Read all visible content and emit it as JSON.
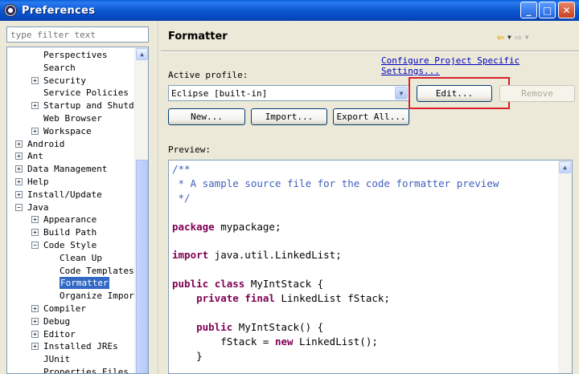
{
  "window": {
    "title": "Preferences",
    "min_glyph": "_",
    "max_glyph": "□",
    "close_glyph": "✕"
  },
  "sidebar": {
    "filter_placeholder": "type filter text",
    "items": [
      {
        "label": "Perspectives",
        "indent": 2,
        "expander": "none"
      },
      {
        "label": "Search",
        "indent": 2,
        "expander": "none"
      },
      {
        "label": "Security",
        "indent": 2,
        "expander": "+"
      },
      {
        "label": "Service Policies",
        "indent": 2,
        "expander": "none"
      },
      {
        "label": "Startup and Shutdo",
        "indent": 2,
        "expander": "+"
      },
      {
        "label": "Web Browser",
        "indent": 2,
        "expander": "none"
      },
      {
        "label": "Workspace",
        "indent": 2,
        "expander": "+"
      },
      {
        "label": "Android",
        "indent": 1,
        "expander": "+"
      },
      {
        "label": "Ant",
        "indent": 1,
        "expander": "+"
      },
      {
        "label": "Data Management",
        "indent": 1,
        "expander": "+"
      },
      {
        "label": "Help",
        "indent": 1,
        "expander": "+"
      },
      {
        "label": "Install/Update",
        "indent": 1,
        "expander": "+"
      },
      {
        "label": "Java",
        "indent": 1,
        "expander": "-"
      },
      {
        "label": "Appearance",
        "indent": 2,
        "expander": "+"
      },
      {
        "label": "Build Path",
        "indent": 2,
        "expander": "+"
      },
      {
        "label": "Code Style",
        "indent": 2,
        "expander": "-"
      },
      {
        "label": "Clean Up",
        "indent": 3,
        "expander": "none"
      },
      {
        "label": "Code Templates",
        "indent": 3,
        "expander": "none"
      },
      {
        "label": "Formatter",
        "indent": 3,
        "expander": "none",
        "selected": true
      },
      {
        "label": "Organize Import",
        "indent": 3,
        "expander": "none"
      },
      {
        "label": "Compiler",
        "indent": 2,
        "expander": "+"
      },
      {
        "label": "Debug",
        "indent": 2,
        "expander": "+"
      },
      {
        "label": "Editor",
        "indent": 2,
        "expander": "+"
      },
      {
        "label": "Installed JREs",
        "indent": 2,
        "expander": "+"
      },
      {
        "label": "JUnit",
        "indent": 2,
        "expander": "none"
      },
      {
        "label": "Properties Files E",
        "indent": 2,
        "expander": "none"
      }
    ]
  },
  "main": {
    "title": "Formatter",
    "config_link": "Configure Project Specific Settings...",
    "active_profile_label": "Active profile:",
    "profile_value": "Eclipse [built-in]",
    "buttons": {
      "edit": "Edit...",
      "remove": "Remove",
      "new": "New...",
      "import": "Import...",
      "export": "Export All..."
    },
    "preview_label": "Preview:",
    "code": [
      [
        {
          "t": "/**",
          "c": "cm"
        }
      ],
      [
        {
          "t": " * A sample source file for the code formatter preview",
          "c": "cm"
        }
      ],
      [
        {
          "t": " */",
          "c": "cm"
        }
      ],
      [],
      [
        {
          "t": "package",
          "c": "kw"
        },
        {
          "t": " mypackage;",
          "c": ""
        }
      ],
      [],
      [
        {
          "t": "import",
          "c": "kw"
        },
        {
          "t": " java.util.LinkedList;",
          "c": ""
        }
      ],
      [],
      [
        {
          "t": "public",
          "c": "kw"
        },
        {
          "t": " ",
          "c": ""
        },
        {
          "t": "class",
          "c": "kw"
        },
        {
          "t": " MyIntStack {",
          "c": ""
        }
      ],
      [
        {
          "t": "    ",
          "c": ""
        },
        {
          "t": "private",
          "c": "kw"
        },
        {
          "t": " ",
          "c": ""
        },
        {
          "t": "final",
          "c": "kw"
        },
        {
          "t": " LinkedList fStack;",
          "c": ""
        }
      ],
      [],
      [
        {
          "t": "    ",
          "c": ""
        },
        {
          "t": "public",
          "c": "kw"
        },
        {
          "t": " MyIntStack() {",
          "c": ""
        }
      ],
      [
        {
          "t": "        fStack = ",
          "c": ""
        },
        {
          "t": "new",
          "c": "kw"
        },
        {
          "t": " LinkedList();",
          "c": ""
        }
      ],
      [
        {
          "t": "    }",
          "c": ""
        }
      ]
    ]
  },
  "colors": {
    "selection": "#316ac5",
    "keyword": "#7f0055",
    "comment": "#3f5fbf",
    "link": "#0000c0",
    "highlight_box": "#d9202a"
  }
}
